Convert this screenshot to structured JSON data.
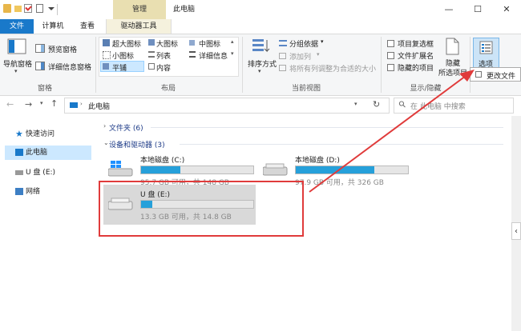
{
  "titlebar": {
    "context_tab": "管理",
    "window_title": "此电脑",
    "minimize": "—",
    "maximize": "☐",
    "close": "✕"
  },
  "tabs": {
    "file": "文件",
    "computer": "计算机",
    "view": "查看",
    "drive_tools": "驱动器工具"
  },
  "ribbon": {
    "pane": {
      "nav_pane": "导航窗格",
      "preview_pane": "预览窗格",
      "details_pane": "详细信息窗格",
      "label": "窗格"
    },
    "layout": {
      "extra_large_icons": "超大图标",
      "large_icons": "大图标",
      "medium_icons": "中图标",
      "small_icons": "小图标",
      "list": "列表",
      "details": "详细信息",
      "tiles": "平铺",
      "content": "内容",
      "label": "布局"
    },
    "current_view": {
      "sort_by": "排序方式",
      "group_by": "分组依据",
      "add_columns": "添加列",
      "size_all_columns": "将所有列调整为合适的大小",
      "label": "当前视图"
    },
    "show_hide": {
      "item_checkboxes": "项目复选框",
      "file_name_extensions": "文件扩展名",
      "hidden_items": "隐藏的项目",
      "hide_selected_items_line1": "隐藏",
      "hide_selected_items_line2": "所选项目",
      "label": "显示/隐藏"
    },
    "options": {
      "label": "选项",
      "menu_item": "更改文件"
    }
  },
  "address": {
    "path": "此电脑",
    "search_placeholder": "在 此电脑 中搜索"
  },
  "sidebar": {
    "items": [
      {
        "label": "快速访问",
        "icon": "star-icon"
      },
      {
        "label": "此电脑",
        "icon": "computer-icon"
      },
      {
        "label": "U 盘 (E:)",
        "icon": "usb-drive-icon"
      },
      {
        "label": "网络",
        "icon": "network-icon"
      }
    ]
  },
  "main": {
    "folders_header": "文件夹 (6)",
    "devices_header": "设备和驱动器 (3)",
    "drives": [
      {
        "name": "本地磁盘 (C:)",
        "info": "95.7 GB 可用，共 148 GB",
        "used": 0.35
      },
      {
        "name": "本地磁盘 (D:)",
        "info": "97.9 GB 可用，共 326 GB",
        "used": 0.7
      },
      {
        "name": "U 盘 (E:)",
        "info": "13.3 GB 可用，共 14.8 GB",
        "used": 0.1
      }
    ]
  },
  "colors": {
    "accent": "#1979ca",
    "highlight_red": "#e03b3b",
    "drive_bar": "#26a0da",
    "context_tab": "#e9dfb1"
  }
}
